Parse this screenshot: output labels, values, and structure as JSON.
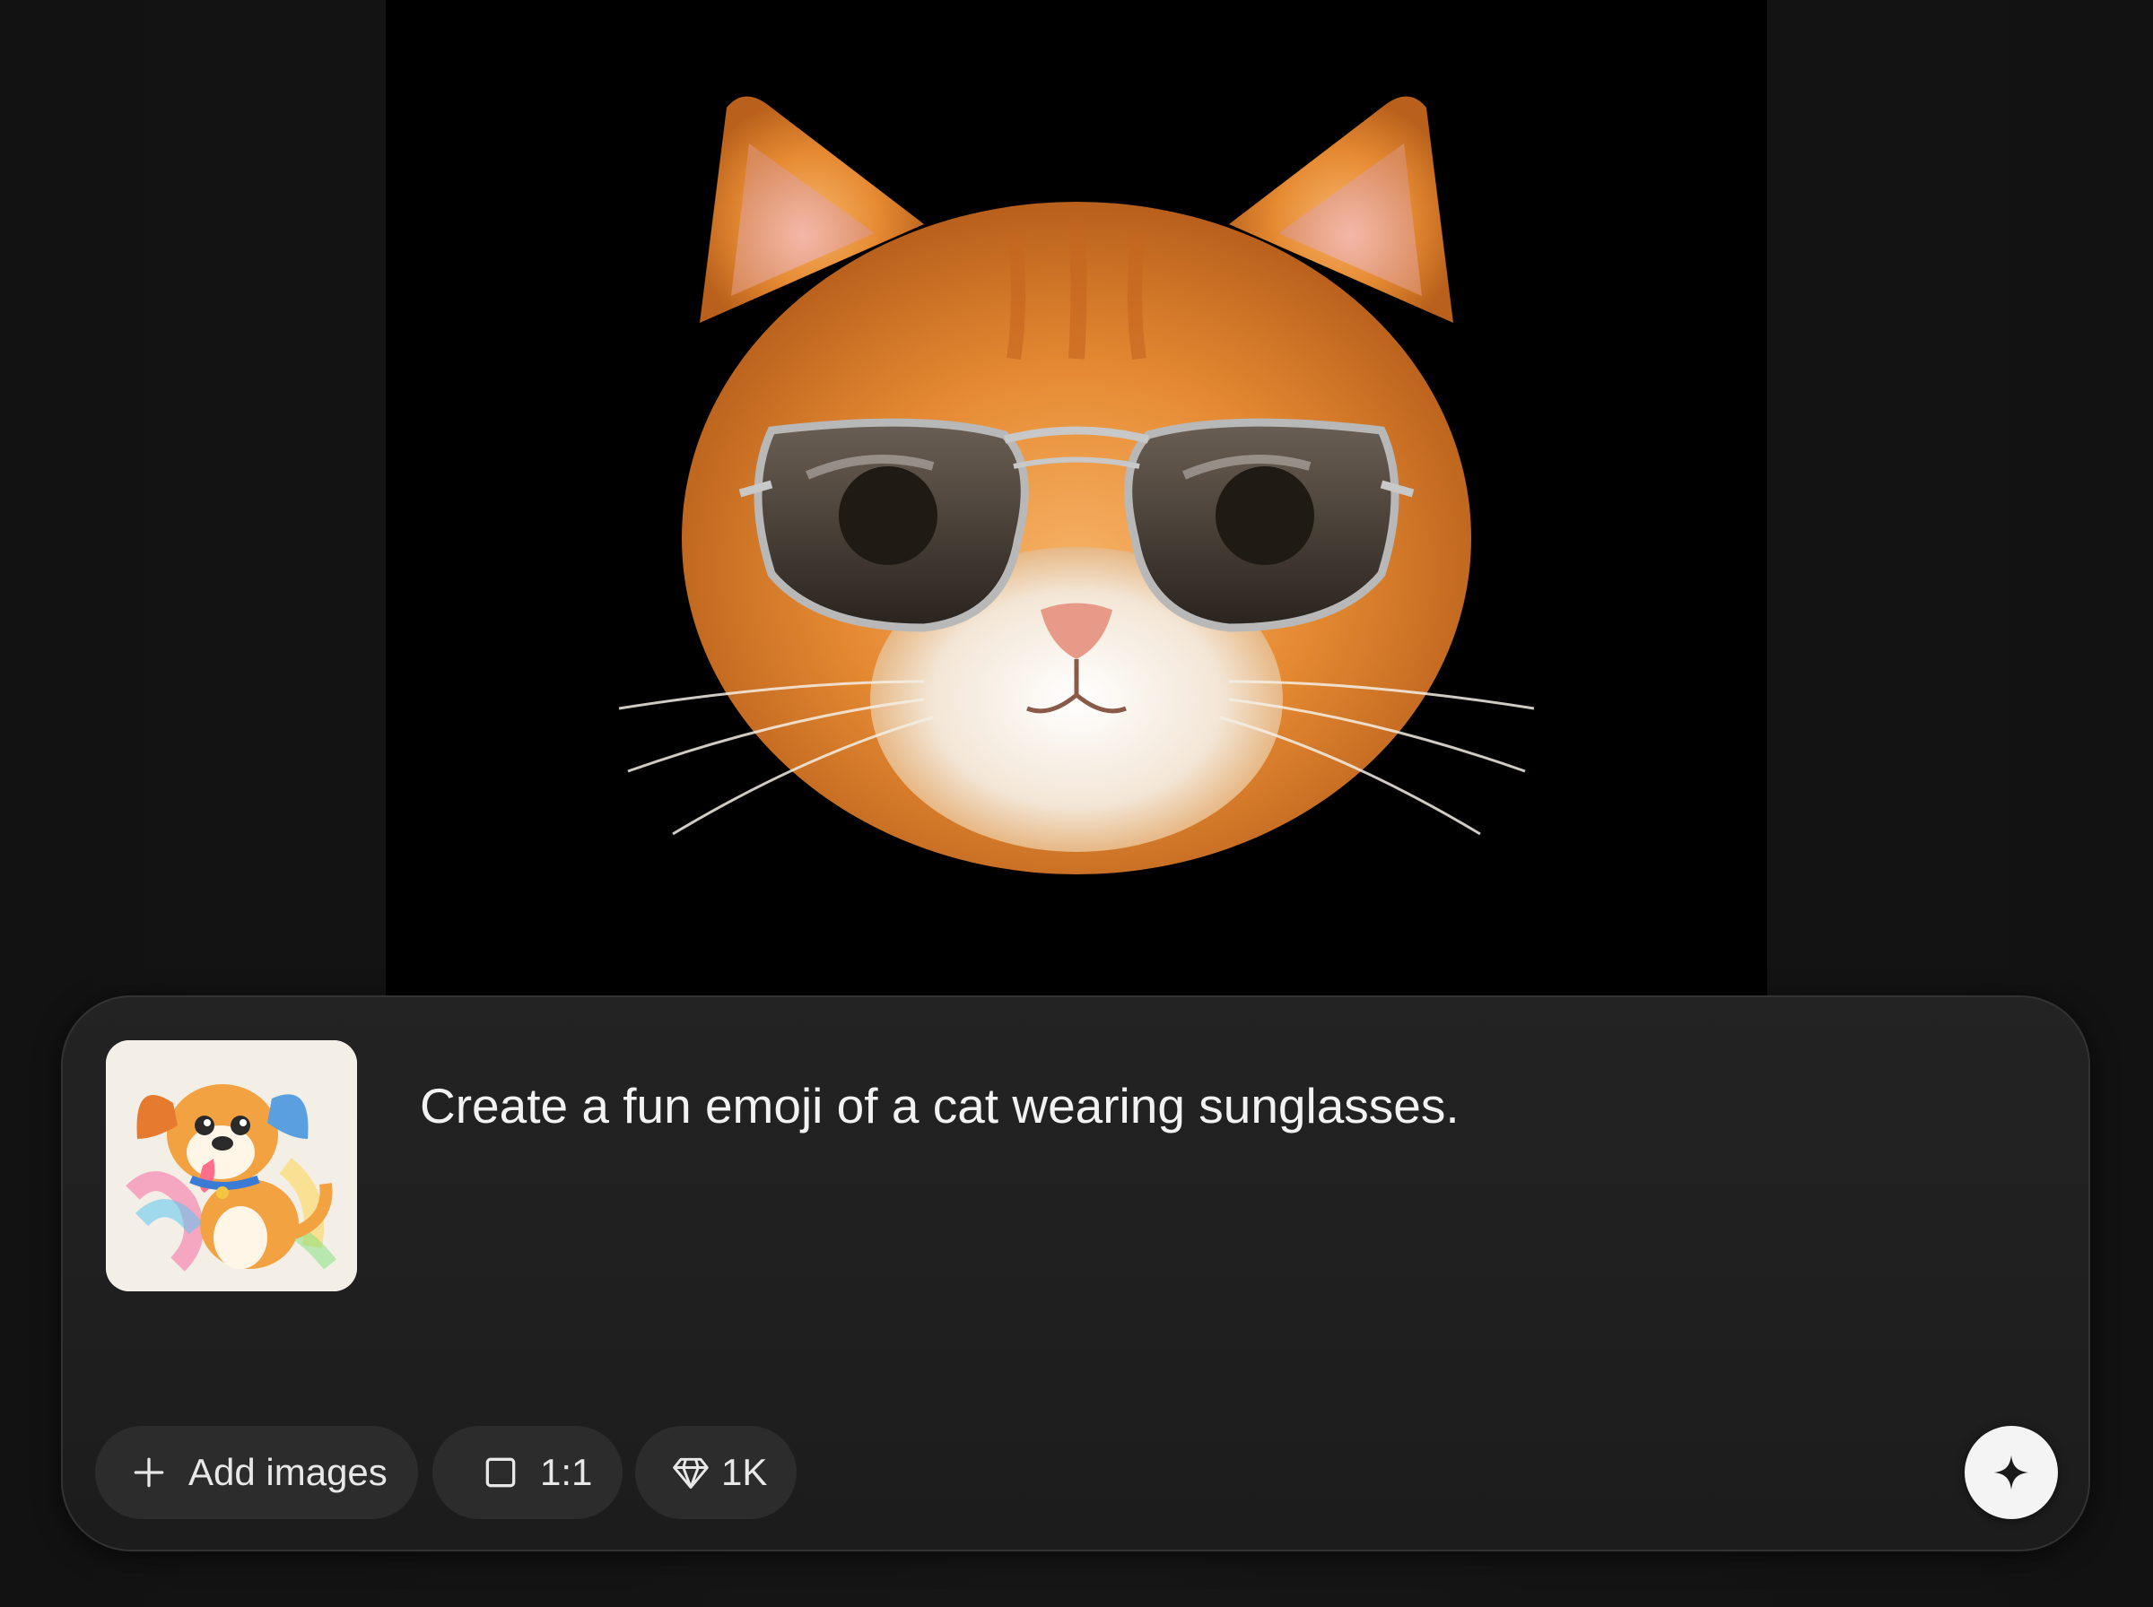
{
  "generated_image": {
    "icon": "cat-with-sunglasses-image"
  },
  "composer": {
    "reference_thumbnail": {
      "icon": "cartoon-dog-image"
    },
    "prompt": "Create a fun emoji of a cat wearing sunglasses.",
    "add_images": {
      "label": "Add images",
      "icon": "plus-icon"
    },
    "aspect_ratio": {
      "label": "1:1",
      "icon": "square-icon"
    },
    "quality": {
      "label": "1K",
      "icon": "diamond-icon"
    },
    "generate": {
      "icon": "sparkle-icon"
    }
  },
  "colors": {
    "background": "#131313",
    "panel": "#1f1f1f",
    "chip": "#2c2c2c",
    "text": "#f2f2f2",
    "generate_button": "#f4f4f4"
  }
}
